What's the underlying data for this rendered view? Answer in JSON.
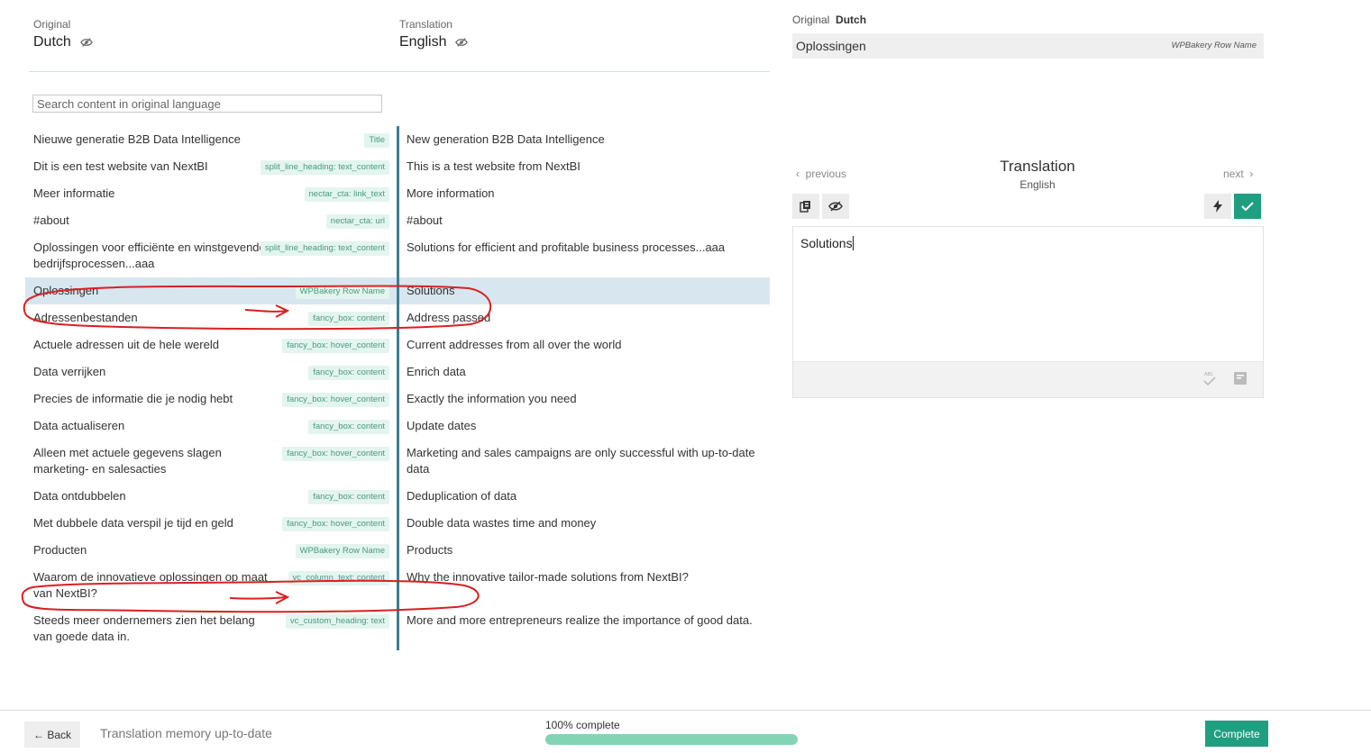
{
  "header": {
    "original_caption": "Original",
    "original_lang": "Dutch",
    "translation_caption": "Translation",
    "translation_lang": "English"
  },
  "search": {
    "placeholder": "Search content in original language"
  },
  "rows": [
    {
      "original": "Nieuwe generatie B2B Data Intelligence",
      "tag": "Title",
      "translation": "New generation B2B Data Intelligence"
    },
    {
      "original": "Dit is een test website van NextBI",
      "tag": "split_line_heading: text_content",
      "translation": "This is a test website from NextBI"
    },
    {
      "original": "Meer informatie",
      "tag": "nectar_cta: link_text",
      "translation": "More information"
    },
    {
      "original": "#about",
      "tag": "nectar_cta: url",
      "translation": "#about"
    },
    {
      "original": "Oplossingen voor efficiënte en winstgevende bedrijfsprocessen...aaa",
      "tag": "split_line_heading: text_content",
      "translation": "Solutions for efficient and profitable business processes...aaa"
    },
    {
      "original": "Oplossingen",
      "tag": "WPBakery Row Name",
      "translation": "Solutions",
      "selected": true
    },
    {
      "original": "Adressenbestanden",
      "tag": "fancy_box: content",
      "translation": "Address passed"
    },
    {
      "original": "Actuele adressen uit de hele wereld",
      "tag": "fancy_box: hover_content",
      "translation": "Current addresses from all over the world"
    },
    {
      "original": "Data verrijken",
      "tag": "fancy_box: content",
      "translation": "Enrich data"
    },
    {
      "original": "Precies de informatie die je nodig hebt",
      "tag": "fancy_box: hover_content",
      "translation": "Exactly the information you need"
    },
    {
      "original": "Data actualiseren",
      "tag": "fancy_box: content",
      "translation": "Update dates"
    },
    {
      "original": "Alleen met actuele gegevens slagen marketing- en salesacties",
      "tag": "fancy_box: hover_content",
      "translation": "Marketing and sales campaigns are only successful with up-to-date data"
    },
    {
      "original": "Data ontdubbelen",
      "tag": "fancy_box: content",
      "translation": "Deduplication of data"
    },
    {
      "original": "Met dubbele data verspil je tijd en geld",
      "tag": "fancy_box: hover_content",
      "translation": "Double data wastes time and money"
    },
    {
      "original": "Producten",
      "tag": "WPBakery Row Name",
      "translation": "Products"
    },
    {
      "original": "Waarom de innovatieve oplossingen op maat van NextBI?",
      "tag": "vc_column_text: content",
      "translation": "Why the innovative tailor-made solutions from NextBI?"
    },
    {
      "original": "Steeds meer ondernemers zien het belang van goede data in.",
      "tag": "vc_custom_heading: text",
      "translation": "More and more entrepreneurs realize the importance of good data."
    }
  ],
  "right": {
    "original_caption": "Original",
    "original_lang": "Dutch",
    "original_text": "Oplossingen",
    "original_tag": "WPBakery Row Name",
    "prev_label": "previous",
    "next_label": "next",
    "translation_title": "Translation",
    "translation_lang": "English",
    "editor_text": "Solutions"
  },
  "footer": {
    "back_label": "← Back",
    "tm_status": "Translation memory up-to-date",
    "progress_label": "100% complete",
    "progress_percent": 100,
    "complete_label": "Complete"
  },
  "colors": {
    "accent": "#1f9f80",
    "separator": "#3d7e8f",
    "selected_row": "#d8e6ef",
    "tag_bg": "#e3f5ee",
    "tag_text": "#4a9a80",
    "progress_fill": "#83d4b5",
    "annotation": "#d92020"
  }
}
